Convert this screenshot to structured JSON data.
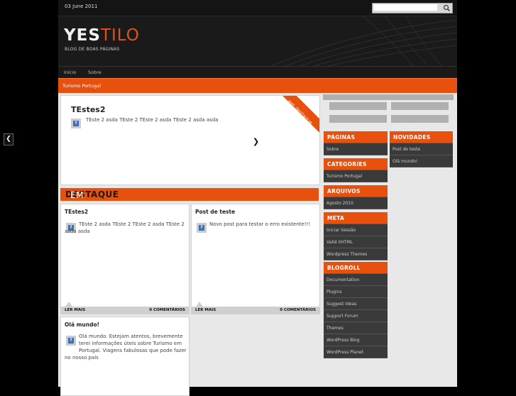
{
  "header": {
    "date": "03 June 2011",
    "search_placeholder": "",
    "logo_part1": "YES",
    "logo_part2": "TILO",
    "tagline": "BLOG DE BOAS PÁGINAS"
  },
  "nav": {
    "items": [
      "Início",
      "Sobre"
    ]
  },
  "category_bar": {
    "label": "Turismo Portugal"
  },
  "featured": {
    "title": "TEstes2",
    "excerpt": "TEste 2 asda TEste 2 TEste 2 asda TEste 2 asda asda",
    "ribbon": "em destaque"
  },
  "section": {
    "label_light": "EM ",
    "label_bold": "DESTAQUE"
  },
  "posts": [
    {
      "title": "TEstes2",
      "line1": "TEste 2 asda TEste 2 TEste 2 asda TEste 2",
      "line2": "asda asda",
      "more": "LER MAIS",
      "comments": "0 COMENTÁRIOS"
    },
    {
      "title": "Post de teste",
      "line1": "Novo post para testar o erro existente!!!",
      "line2": "",
      "more": "LER MAIS",
      "comments": "0 COMENTÁRIOS"
    },
    {
      "title": "Olá mundo!",
      "line1": "Olá mundo. Estejam atentos, brevemente",
      "line2": "terei informações úteis sobre Turismo em",
      "line3": "Portugal. Viagens fabulosas que pode fazer",
      "line4": "no nosso país"
    }
  ],
  "sidebar": {
    "paginas": {
      "title": "PÁGINAS",
      "items": [
        "Sobre"
      ]
    },
    "categories": {
      "title": "CATEGORIES",
      "items": [
        "Turismo Portugal"
      ]
    },
    "arquivos": {
      "title": "ARQUIVOS",
      "items": [
        "Agosto 2010"
      ]
    },
    "meta": {
      "title": "META",
      "items": [
        "Iniciar Sessão",
        "Valid XHTML",
        "Wordpress Themes"
      ]
    },
    "blogroll": {
      "title": "BLOGROLL",
      "items": [
        "Documentation",
        "Plugins",
        "Suggest Ideas",
        "Support Forum",
        "Themes",
        "WordPress Blog",
        "WordPress Planet"
      ]
    },
    "novidades": {
      "title": "NOVIDADES",
      "items": [
        "Post de teste",
        "Olá mundo!"
      ]
    }
  },
  "colors": {
    "accent": "#e8500d",
    "dark": "#1a1a1a",
    "widget_bg": "#3a3a3a"
  },
  "icons": [
    "search-icon",
    "post-format-icon",
    "next-arrow-icon",
    "prev-arrow-icon"
  ]
}
